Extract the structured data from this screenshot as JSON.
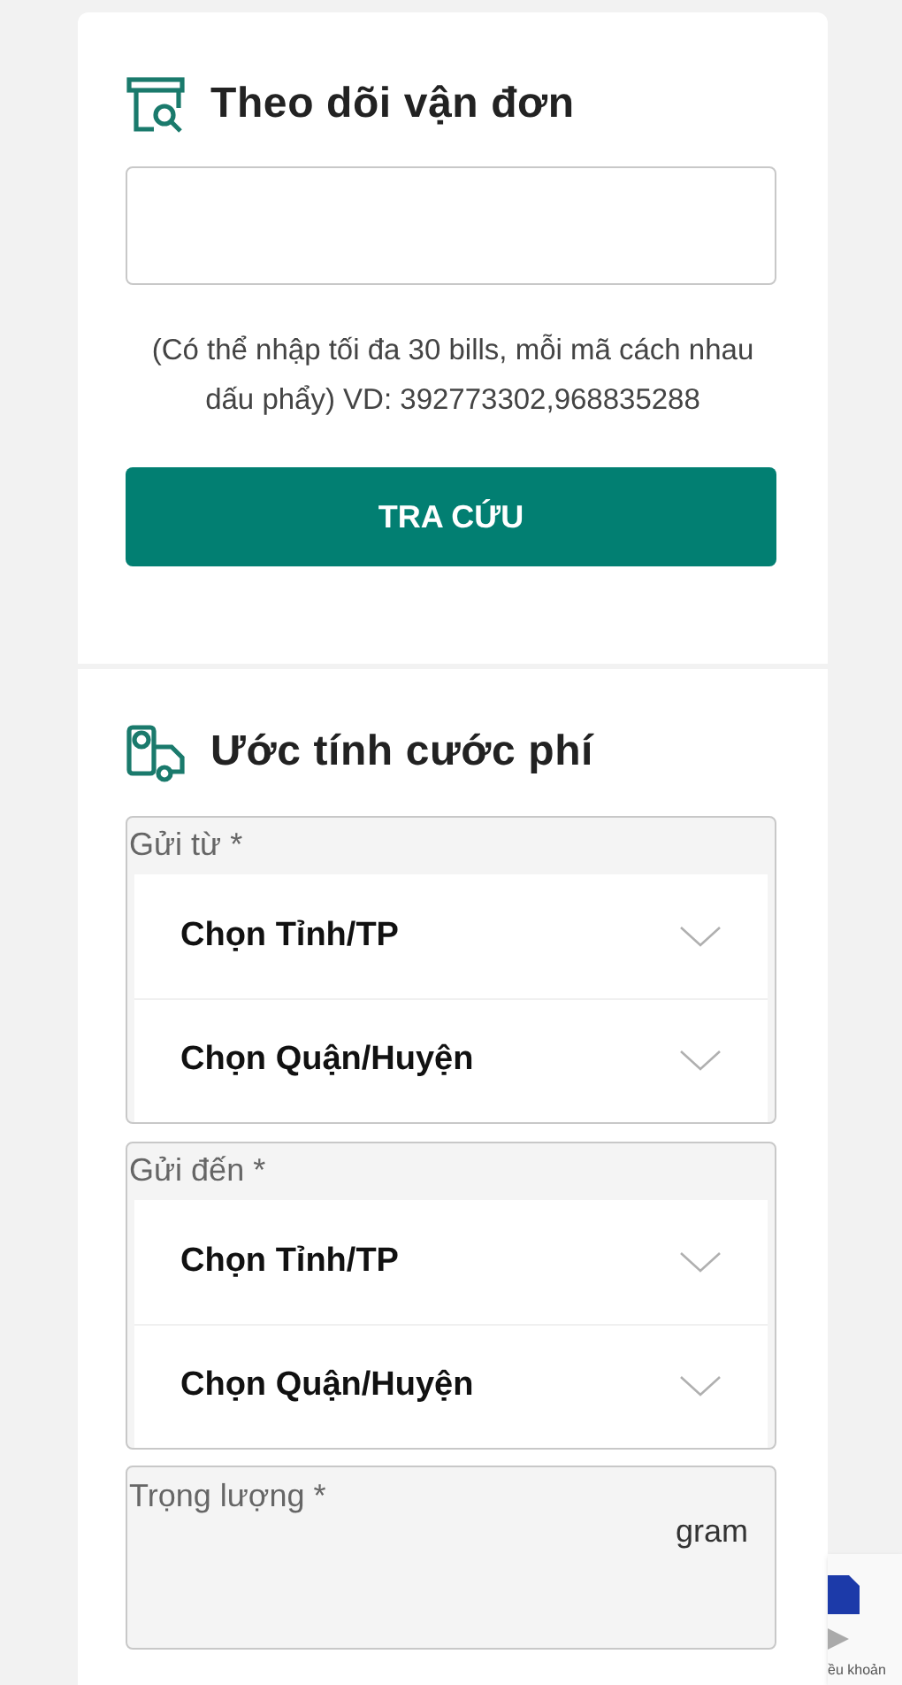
{
  "tracking": {
    "title": "Theo dõi vận đơn",
    "hint": "(Có thể nhập tối đa 30 bills, mỗi mã cách nhau dấu phẩy) VD: 392773302,968835288",
    "button": "TRA CỨU"
  },
  "estimate": {
    "title": "Ước tính cước phí",
    "groups": [
      {
        "label": "Gửi từ *",
        "selects": [
          "Chọn Tỉnh/TP",
          "Chọn Quận/Huyện"
        ]
      },
      {
        "label": "Gửi đến *",
        "selects": [
          "Chọn Tỉnh/TP",
          "Chọn Quận/Huyện"
        ]
      }
    ],
    "weight": {
      "label": "Trọng lượng *",
      "unit": "gram"
    }
  },
  "recaptcha": {
    "text": "ều khoản"
  }
}
